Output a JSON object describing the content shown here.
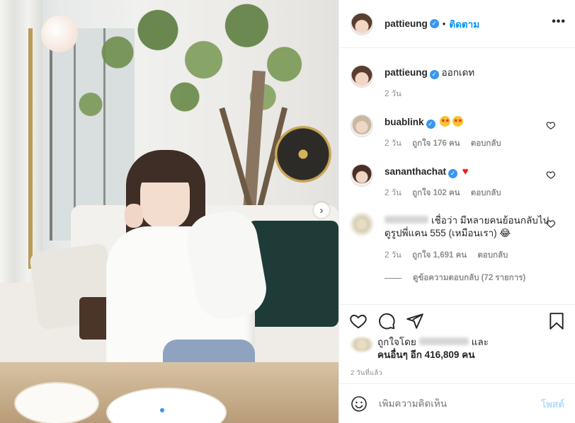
{
  "post": {
    "owner": "pattieung",
    "follow_label": "ติดตาม",
    "more_label": "•••",
    "caption_text": "ออกเดท",
    "caption_time": "2 วัน",
    "next_icon": "›",
    "slide_dots": 3,
    "current_slide": 1
  },
  "comments": [
    {
      "username": "buablink",
      "time": "2 วัน",
      "likes": "ถูกใจ 176 คน",
      "reply": "ตอบกลับ",
      "emoji": "star-struck x2"
    },
    {
      "username": "sananthachat",
      "time": "2 วัน",
      "likes": "ถูกใจ 102 คน",
      "reply": "ตอบกลับ",
      "emoji": "red-heart"
    },
    {
      "text": "เชื่อว่า มีหลายคนย้อนกลับไปดูรูปพี่แคน 555 (เหมือนเรา) 😂",
      "time": "2 วัน",
      "likes": "ถูกใจ 1,691 คน",
      "reply": "ตอบกลับ"
    }
  ],
  "view_replies": "ดูข้อความตอบกลับ (72 รายการ)",
  "likes": {
    "liked_by": "ถูกใจโดย",
    "and": "และ",
    "others": "คนอื่นๆ อีก 416,809 คน"
  },
  "time_ago": "2 วันที่แล้ว",
  "add_comment": {
    "placeholder": "เพิ่มความคิดเห็น",
    "post_label": "โพสต์"
  },
  "colors": {
    "accent": "#0095f6",
    "post_disabled": "#b2dffc",
    "muted": "#8e8e8e",
    "verified": "#3897f0"
  }
}
